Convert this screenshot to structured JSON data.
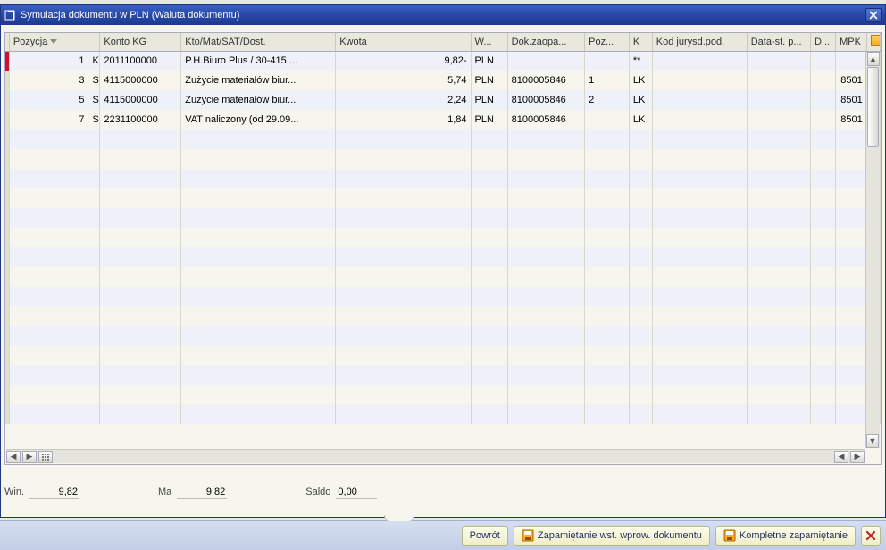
{
  "dialog": {
    "title": "Symulacja dokumentu w PLN (Waluta dokumentu)"
  },
  "columns": {
    "pozycja": "Pozycja",
    "konto": "Konto KG",
    "kto": "Kto/Mat/SAT/Dost.",
    "kwota": "Kwota",
    "w": "W...",
    "dok": "Dok.zaopa...",
    "poz": "Poz...",
    "k": "K",
    "jurysd": "Kod jurysd.pod.",
    "data": "Data-st. p...",
    "d": "D...",
    "mpk": "MPK"
  },
  "rows": [
    {
      "pozycja": "1",
      "k1": "K",
      "konto": "2011100000",
      "kto": "P.H.Biuro Plus / 30-415 ...",
      "kwota": "9,82-",
      "w": "PLN",
      "dok": "",
      "poz": "",
      "k": "**",
      "jurysd": "",
      "data": "",
      "d": "",
      "mpk": "",
      "marked": true
    },
    {
      "pozycja": "3",
      "k1": "S",
      "konto": "4115000000",
      "kto": "Zużycie materiałów biur...",
      "kwota": "5,74",
      "w": "PLN",
      "dok": "8100005846",
      "poz": "1",
      "k": "LK",
      "jurysd": "",
      "data": "",
      "d": "",
      "mpk": "8501"
    },
    {
      "pozycja": "5",
      "k1": "S",
      "konto": "4115000000",
      "kto": "Zużycie materiałów biur...",
      "kwota": "2,24",
      "w": "PLN",
      "dok": "8100005846",
      "poz": "2",
      "k": "LK",
      "jurysd": "",
      "data": "",
      "d": "",
      "mpk": "8501"
    },
    {
      "pozycja": "7",
      "k1": "S",
      "konto": "2231100000",
      "kto": "VAT naliczony (od 29.09...",
      "kwota": "1,84",
      "w": "PLN",
      "dok": "8100005846",
      "poz": "",
      "k": "LK",
      "jurysd": "",
      "data": "",
      "d": "",
      "mpk": "8501"
    }
  ],
  "totals": {
    "win_label": "Win.",
    "win_value": "9,82",
    "ma_label": "Ma",
    "ma_value": "9,82",
    "saldo_label": "Saldo",
    "saldo_value": "0,00"
  },
  "footer": {
    "powrot": "Powrót",
    "zap_wst": "Zapamiętanie wst. wprow. dokumentu",
    "kompletne": "Kompletne zapamiętanie"
  }
}
